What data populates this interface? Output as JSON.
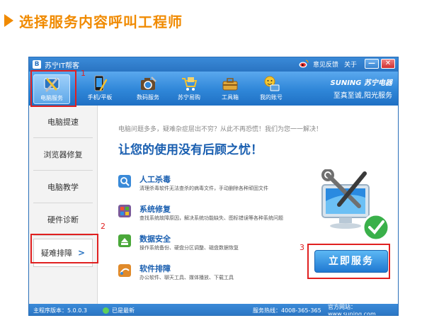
{
  "heading": "选择服务内容呼叫工程师",
  "window": {
    "title": "苏宁IT帮客",
    "logo_letter": "B",
    "titlebar_links": [
      "意见反馈",
      "关于"
    ],
    "min_label": "—",
    "close_label": "✕"
  },
  "toolbar": {
    "items": [
      {
        "label": "电脑服务"
      },
      {
        "label": "手机/平板"
      },
      {
        "label": "数码服务"
      },
      {
        "label": "苏宁易购"
      },
      {
        "label": "工具箱"
      },
      {
        "label": "我的账号"
      }
    ],
    "brand_name": "SUNING 苏宁电器",
    "brand_slogan": "至真至诚,阳光服务"
  },
  "sidebar": {
    "items": [
      {
        "label": "电脑提速"
      },
      {
        "label": "浏览器修复"
      },
      {
        "label": "电脑教学"
      },
      {
        "label": "硬件诊断"
      },
      {
        "label": "疑难排障",
        "chevron": ">"
      }
    ]
  },
  "content": {
    "lead": "电脑问题多多，疑难杂症层出不穷？从此不再恐慌！我们为您一一解决！",
    "headline": "让您的使用没有后顾之忧！",
    "features": [
      {
        "title": "人工杀毒",
        "desc": "清理杀毒软件无法查杀的病毒文件，手动删除各种顽固文件"
      },
      {
        "title": "系统修复",
        "desc": "查找系统故障原因，解决系统功能缺失、图标错误等各种系统问题"
      },
      {
        "title": "数据安全",
        "desc": "操作系统备份、硬盘分区调整、磁盘数据恢复"
      },
      {
        "title": "软件排障",
        "desc": "办公软件、聊天工具、媒体播放、下载工具"
      }
    ],
    "serve_button": "立即服务"
  },
  "statusbar": {
    "version": "主程序版本：5.0.0.3",
    "status": "已是最新",
    "hotline": "服务热线：4008-365-365",
    "website": "官方网站：www.suning.com"
  },
  "markers": [
    "1",
    "2",
    "3"
  ],
  "colors": {
    "accent_orange": "#f08a00",
    "brand_blue": "#2a74c2",
    "annotation_red": "#e02020"
  }
}
